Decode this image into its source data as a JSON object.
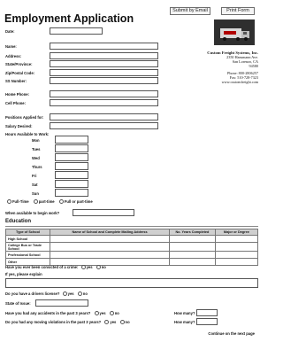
{
  "buttons": {
    "submit": "Submit by Email",
    "print": "Print Form"
  },
  "title": "Employment Application",
  "company": {
    "name": "Custom Freight Systems, Inc.",
    "address1": "2350 Hansmann Ave.",
    "address2": "San Lorenzo, CA",
    "address3": "94580",
    "phone": "Phone: 800-2806257",
    "fax": "Fax: 510-728-7323",
    "web": "www.customfreight.com"
  },
  "fields": {
    "date": "Date:",
    "name": "Name:",
    "address": "Address:",
    "state": "State/Province:",
    "zip": "Zip/Postal Code:",
    "ssn": "SS Number:",
    "home_phone": "Home Phone:",
    "cell_phone": "Cell Phone:",
    "position": "Positions Applied for:",
    "salary": "Salary Desired:"
  },
  "hours": {
    "label": "Hours Available to Work:",
    "days": [
      "Mon",
      "Tues",
      "Wed",
      "Thurs",
      "Fri",
      "Sat",
      "Sun"
    ]
  },
  "availability": {
    "options": [
      "Full-Time",
      "part-time",
      "Full or part-time"
    ],
    "begin": "When available to begin work?"
  },
  "education": {
    "title": "Education",
    "headers": [
      "Type of School",
      "Name of School and Complete Mailing Address",
      "No. Years Completed",
      "Major or Degree"
    ],
    "rows": [
      "High School",
      "College Bus or Trade School",
      "Professional School",
      "Other"
    ]
  },
  "questions": {
    "crime": "Have you ever been convicted of a crime:",
    "crime_yes": "yes",
    "crime_no": "no",
    "explain": "If yes, please explain",
    "license": "Do you have a drivers license?",
    "license_yes": "yes",
    "license_no": "no",
    "state_issue": "State of Issue:",
    "accidents": "Have you had any accidents in the past 3 years?",
    "accidents_yes": "yes",
    "accidents_no": "no",
    "violations": "Do you had any moving violations in the past 3 years?",
    "violations_yes": "yes",
    "violations_no": "no",
    "how_many": "How many?"
  },
  "footer": "Continue on the next page"
}
